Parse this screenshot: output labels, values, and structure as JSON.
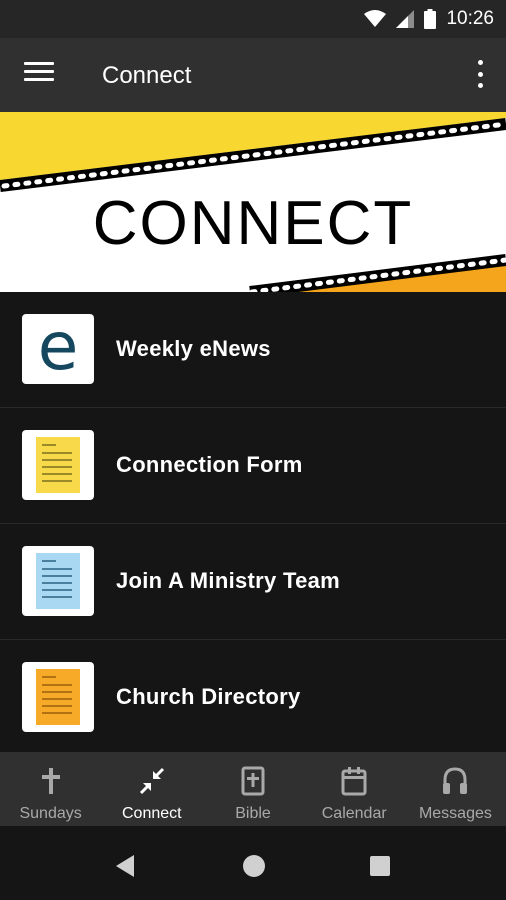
{
  "status_bar": {
    "time": "10:26"
  },
  "app_bar": {
    "title": "Connect"
  },
  "banner": {
    "text": "CONNECT"
  },
  "list": {
    "items": [
      {
        "label": "Weekly eNews",
        "icon": "e-icon",
        "icon_glyph": "e"
      },
      {
        "label": "Connection Form",
        "icon": "yellow-document-icon"
      },
      {
        "label": "Join A Ministry Team",
        "icon": "blue-document-icon"
      },
      {
        "label": "Church Directory",
        "icon": "orange-document-icon"
      }
    ]
  },
  "bottom_nav": {
    "items": [
      {
        "label": "Sundays",
        "icon": "cross-icon"
      },
      {
        "label": "Connect",
        "icon": "connect-arrows-icon",
        "active": true
      },
      {
        "label": "Bible",
        "icon": "bible-icon"
      },
      {
        "label": "Calendar",
        "icon": "calendar-icon"
      },
      {
        "label": "Messages",
        "icon": "headphones-icon"
      }
    ]
  },
  "colors": {
    "app_bar": "#303030",
    "background": "#151515",
    "banner_yellow": "#f7d730",
    "banner_orange": "#f5a51b",
    "enews_blue": "#15485f"
  }
}
